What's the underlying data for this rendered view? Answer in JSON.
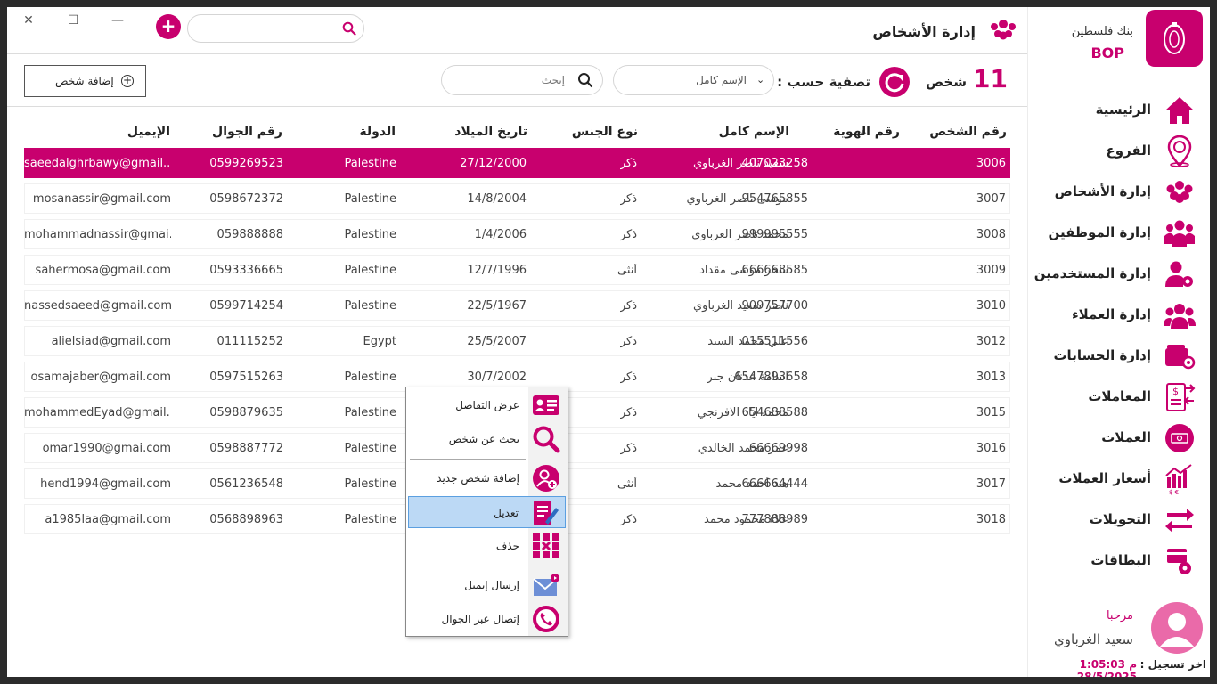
{
  "window": {
    "close_glyph": "✕",
    "maximize_glyph": "☐",
    "minimize_glyph": "—"
  },
  "header": {
    "title": "إدارة الأشخاص",
    "add_glyph": "+",
    "search_value": ""
  },
  "toolbar": {
    "count": "11",
    "count_label": "شخص",
    "filter_label": "تصفية حسب :",
    "filter_value": "الإسم كامل",
    "search_placeholder": "إبحث",
    "add_person_label": "إضافة شخص",
    "add_person_glyph": "+"
  },
  "table": {
    "columns": {
      "id": "رقم الشخص",
      "national_id": "رقم الهوية",
      "name": "الإسم كامل",
      "gender": "نوع الجنس",
      "birth": "تاريخ الميلاد",
      "country": "الدولة",
      "phone": "رقم الجوال",
      "email": "الإيميل"
    },
    "rows": [
      {
        "id": "3006",
        "national_id": "407023258",
        "name": "سعيد ناصر الغرباوي",
        "gender": "ذكر",
        "birth": "27/12/2000",
        "country": "Palestine",
        "phone": "0599269523",
        "email": "saeedalghrbawy@gmail...."
      },
      {
        "id": "3007",
        "national_id": "954765855",
        "name": "موسى ناصر الغرباوي",
        "gender": "ذكر",
        "birth": "14/8/2004",
        "country": "Palestine",
        "phone": "0598672372",
        "email": "mosanassir@gmail.com"
      },
      {
        "id": "3008",
        "national_id": "999995555",
        "name": "محمد ناصر الغرباوي",
        "gender": "ذكر",
        "birth": "1/4/2006",
        "country": "Palestine",
        "phone": "059888888",
        "email": "mohammadnassir@gmai..."
      },
      {
        "id": "3009",
        "national_id": "666668585",
        "name": "سحر موسى مقداد",
        "gender": "أنثى",
        "birth": "12/7/1996",
        "country": "Palestine",
        "phone": "0593336665",
        "email": "sahermosa@gmail.com"
      },
      {
        "id": "3010",
        "national_id": "909757700",
        "name": "ناصر سعيد الغرباوي",
        "gender": "ذكر",
        "birth": "22/5/1967",
        "country": "Palestine",
        "phone": "0599714254",
        "email": "nassedsaeed@gmail.com"
      },
      {
        "id": "3012",
        "national_id": "015511556",
        "name": "علي محمد السيد",
        "gender": "ذكر",
        "birth": "25/5/2007",
        "country": "Egypt",
        "phone": "011115252",
        "email": "alielsiad@gmail.com"
      },
      {
        "id": "3013",
        "national_id": "6547893658",
        "name": "أسامة عدنان جبر",
        "gender": "ذكر",
        "birth": "30/7/2002",
        "country": "Palestine",
        "phone": "0597515263",
        "email": "osamajaber@gmail.com"
      },
      {
        "id": "3015",
        "national_id": "654688588",
        "name": "محمد اياد الافرنجي",
        "gender": "ذكر",
        "birth": "",
        "country": "Palestine",
        "phone": "0598879635",
        "email": "mohammedEyad@gmail...."
      },
      {
        "id": "3016",
        "national_id": "66669998",
        "name": "عمر محمد الخالدي",
        "gender": "ذكر",
        "birth": "",
        "country": "Palestine",
        "phone": "0598887772",
        "email": "omar1990@gmai.com"
      },
      {
        "id": "3017",
        "national_id": "666664444",
        "name": "هند أحمد محمد",
        "gender": "أنثى",
        "birth": "",
        "country": "Palestine",
        "phone": "0561236548",
        "email": "hend1994@gmail.com"
      },
      {
        "id": "3018",
        "national_id": "777888989",
        "name": "علاء محمود محمد",
        "gender": "ذكر",
        "birth": "",
        "country": "Palestine",
        "phone": "0568898963",
        "email": "a1985laa@gmail.com"
      }
    ]
  },
  "context_menu": {
    "items": [
      {
        "label": "عرض التفاصل",
        "icon": "id-card-icon"
      },
      {
        "label": "بحث عن شخص",
        "icon": "search-icon"
      },
      {
        "label": "إضافة شخص جديد",
        "icon": "add-user-icon"
      },
      {
        "label": "تعديل",
        "icon": "edit-document-icon"
      },
      {
        "label": "حذف",
        "icon": "delete-grid-icon"
      },
      {
        "label": "إرسال إيميل",
        "icon": "mail-icon"
      },
      {
        "label": "إتصال عبر الجوال",
        "icon": "phone-icon"
      }
    ]
  },
  "sidebar": {
    "bank_name": "بنك فلسطين",
    "bank_code": "BOP",
    "items": [
      {
        "label": "الرئيسية",
        "icon": "home-icon"
      },
      {
        "label": "الفروع",
        "icon": "branch-location-icon"
      },
      {
        "label": "إدارة الأشخاص",
        "icon": "people-group-icon"
      },
      {
        "label": "إدارة الموظفين",
        "icon": "employees-icon"
      },
      {
        "label": "إدارة المستخدمين",
        "icon": "user-settings-icon"
      },
      {
        "label": "إدارة العملاء",
        "icon": "clients-icon"
      },
      {
        "label": "إدارة الحسابات",
        "icon": "wallet-settings-icon"
      },
      {
        "label": "المعاملات",
        "icon": "transactions-icon"
      },
      {
        "label": "العملات",
        "icon": "currency-icon"
      },
      {
        "label": "أسعار العملات",
        "icon": "exchange-rates-icon"
      },
      {
        "label": "التحويلات",
        "icon": "transfer-arrows-icon"
      },
      {
        "label": "البطاقات",
        "icon": "cards-icon"
      }
    ],
    "welcome": "مرحبا",
    "user_name": "سعيد الغرباوي",
    "last_login_label": "اخر تسجيل :",
    "last_login_value": "م 1:05:03 28/5/2025"
  },
  "colors": {
    "accent": "#c8006e",
    "selected_row": "#c8006e",
    "menu_highlight": "#bcd9f5"
  }
}
